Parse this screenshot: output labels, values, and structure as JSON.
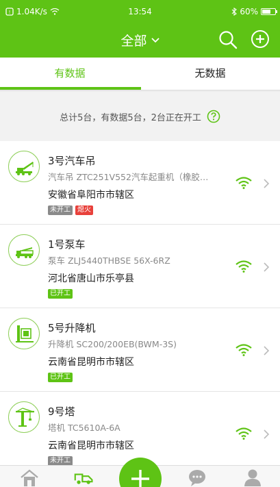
{
  "status_bar": {
    "speed": "1.04K/s",
    "time": "13:54",
    "battery": "60%"
  },
  "header": {
    "title": "全部"
  },
  "tabs": [
    {
      "label": "有数据"
    },
    {
      "label": "无数据"
    }
  ],
  "summary": {
    "text": "总计5台，有数据5台，2台正在开工"
  },
  "items": [
    {
      "name": "3号汽车吊",
      "model": "汽车吊 ZTC251V552汽车起重机（橡胶…",
      "location": "安徽省阜阳市市辖区",
      "badges": [
        "未开工",
        "熄火"
      ],
      "icon": "truck-crane-icon"
    },
    {
      "name": "1号泵车",
      "model": "泵车 ZLJ5440THBSE 56X-6RZ",
      "location": "河北省唐山市乐亭县",
      "badges": [
        "已开工"
      ],
      "icon": "pump-truck-icon"
    },
    {
      "name": "5号升降机",
      "model": "升降机 SC200/200EB(BWM-3S)",
      "location": "云南省昆明市市辖区",
      "badges": [
        "已开工"
      ],
      "icon": "elevator-icon"
    },
    {
      "name": "9号塔",
      "model": "塔机 TC5610A-6A",
      "location": "云南省昆明市市辖区",
      "badges": [
        "未开工"
      ],
      "icon": "tower-crane-icon"
    }
  ],
  "colors": {
    "brand": "#5ec315",
    "badge_off": "#8a8a8a",
    "badge_alert": "#e8413b"
  }
}
